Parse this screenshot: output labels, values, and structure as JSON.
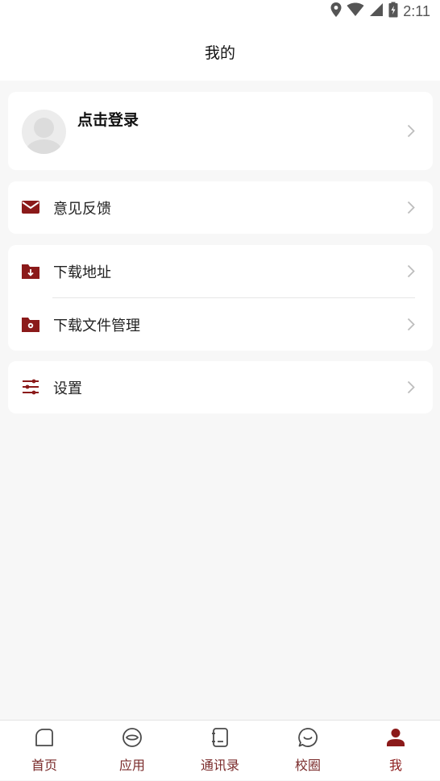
{
  "status_bar": {
    "time": "2:11"
  },
  "header": {
    "title": "我的"
  },
  "profile": {
    "login_label": "点击登录"
  },
  "menu": {
    "feedback": "意见反馈",
    "download_address": "下载地址",
    "download_files": "下载文件管理",
    "settings": "设置"
  },
  "tabs": [
    {
      "label": "首页",
      "icon": "home-icon"
    },
    {
      "label": "应用",
      "icon": "apps-icon"
    },
    {
      "label": "通讯录",
      "icon": "contacts-icon"
    },
    {
      "label": "校圈",
      "icon": "chat-icon"
    },
    {
      "label": "我",
      "icon": "profile-icon",
      "active": true
    }
  ],
  "colors": {
    "accent": "#8b1a1a",
    "tab_text": "#7a2b2b",
    "background": "#f7f7f7"
  }
}
